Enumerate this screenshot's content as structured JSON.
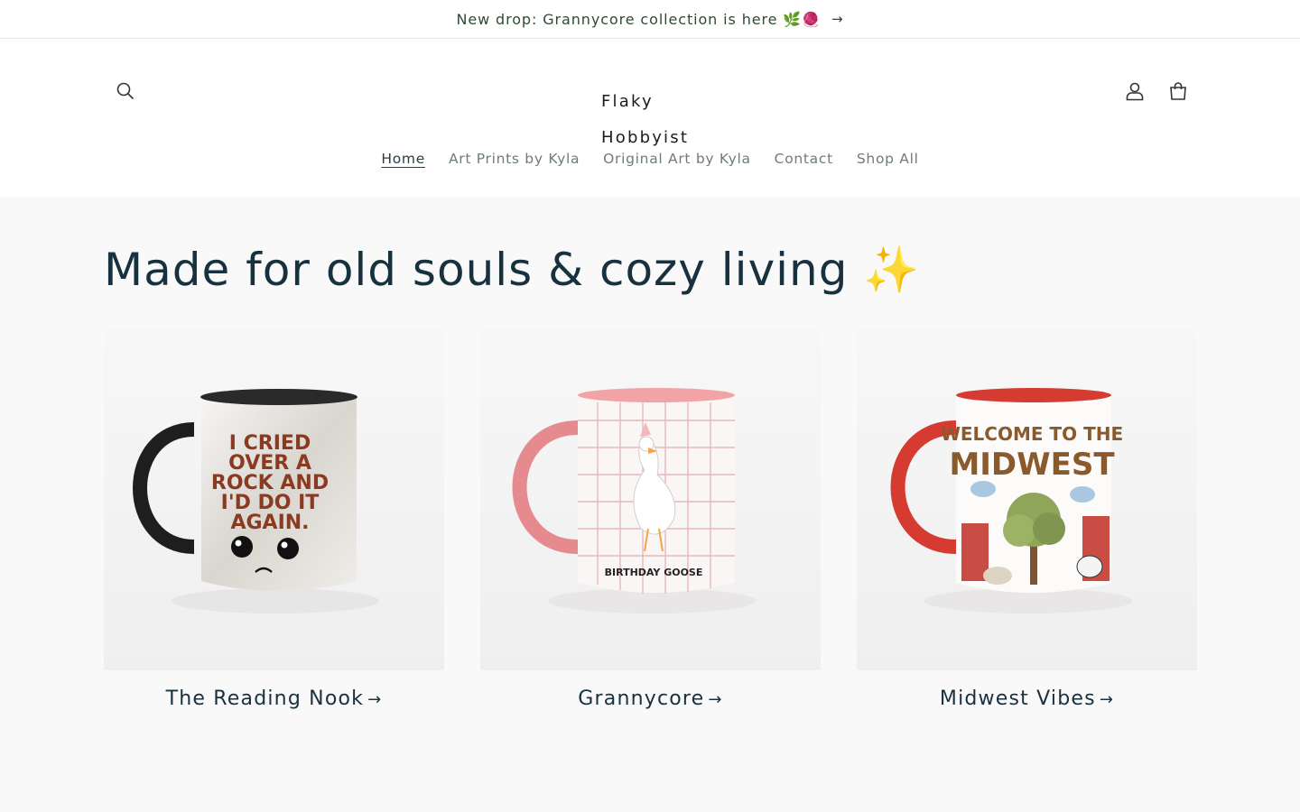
{
  "announcement": {
    "text": "New drop: Grannycore collection is here 🌿🧶",
    "arrow": "→"
  },
  "header": {
    "logo_line1": "Flaky",
    "logo_line2": "Hobbyist",
    "nav": [
      {
        "label": "Home",
        "active": true
      },
      {
        "label": "Art Prints by Kyla"
      },
      {
        "label": "Original Art by Kyla"
      },
      {
        "label": "Contact"
      },
      {
        "label": "Shop All"
      }
    ],
    "icons": [
      "search-icon",
      "account-icon",
      "cart-icon"
    ]
  },
  "main": {
    "heading": "Made for old souls & cozy living ✨",
    "collections": [
      {
        "title": "The Reading Nook",
        "arrow": "→",
        "mug_text": [
          "I CRIED",
          "OVER A",
          "ROCK AND",
          "I'D DO IT",
          "AGAIN."
        ],
        "accent": "#2b2b2b"
      },
      {
        "title": "Grannycore",
        "arrow": "→",
        "mug_text": [
          "BIRTHDAY GOOSE"
        ],
        "accent": "#e58b8f"
      },
      {
        "title": "Midwest Vibes",
        "arrow": "→",
        "mug_text": [
          "WELCOME TO THE",
          "MIDWEST"
        ],
        "accent": "#d63b32"
      }
    ]
  },
  "colors": {
    "heading": "#18313f",
    "nav": "#6d7f6f",
    "announcement": "#2f4a35",
    "section_bg": "#f9f9f9"
  }
}
